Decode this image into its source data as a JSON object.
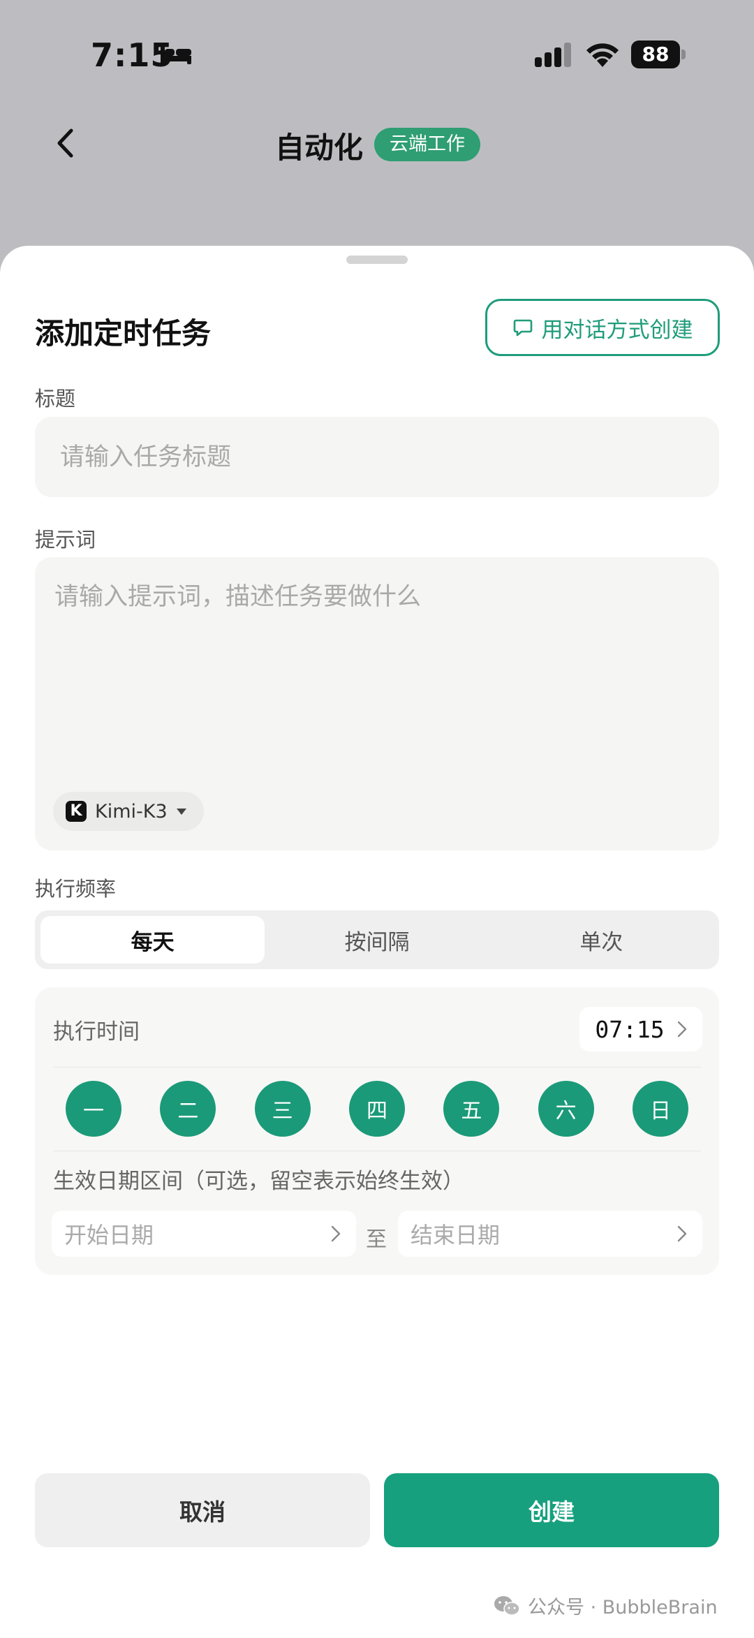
{
  "status_bar": {
    "time": "7:15",
    "battery": "88",
    "icons": [
      "bed-icon",
      "signal-icon",
      "wifi-icon",
      "battery-icon"
    ]
  },
  "nav": {
    "back_icon": "chevron-left-icon",
    "title": "自动化",
    "badge": "云端工作"
  },
  "sheet": {
    "title": "添加定时任务",
    "chat_create_label": "用对话方式创建",
    "title_field": {
      "label": "标题",
      "placeholder": "请输入任务标题",
      "value": ""
    },
    "prompt_field": {
      "label": "提示词",
      "placeholder": "请输入提示词，描述任务要做什么",
      "value": ""
    },
    "model": {
      "name": "Kimi-K3",
      "logo_letter": "K"
    },
    "frequency": {
      "label": "执行频率",
      "options": [
        "每天",
        "按间隔",
        "单次"
      ],
      "selected": "每天"
    },
    "schedule": {
      "exec_time_label": "执行时间",
      "exec_time": "07:15",
      "weekdays": [
        "一",
        "二",
        "三",
        "四",
        "五",
        "六",
        "日"
      ],
      "range_label": "生效日期区间（可选，留空表示始终生效）",
      "start_placeholder": "开始日期",
      "to_label": "至",
      "end_placeholder": "结束日期"
    },
    "actions": {
      "cancel": "取消",
      "create": "创建"
    }
  },
  "watermark": {
    "text": "公众号 · BubbleBrain"
  },
  "colors": {
    "accent": "#16a07e",
    "badge": "#2f9e73",
    "overlay": "#bdbdc1"
  }
}
